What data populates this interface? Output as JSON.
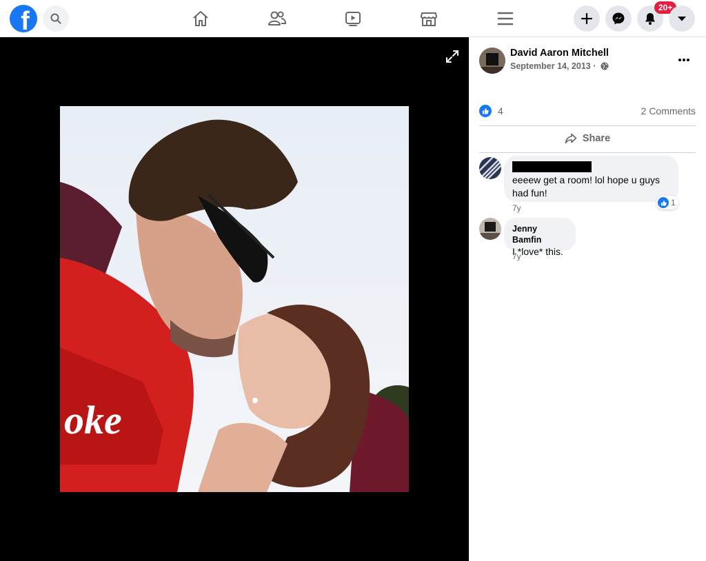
{
  "topbar": {
    "logo_letter": "f",
    "notification_badge": "20+",
    "icons": [
      "facebook-logo",
      "search-icon",
      "home-icon",
      "friends-icon",
      "watch-icon",
      "marketplace-icon",
      "menu-icon",
      "create-icon",
      "messenger-icon",
      "notifications-icon",
      "account-dropdown-icon"
    ]
  },
  "post": {
    "author": "David Aaron Mitchell",
    "date": "September 14, 2013 ·",
    "privacy_icon": "globe-icon",
    "reaction_count": "4",
    "comments_count": "2 Comments",
    "share_label": "Share"
  },
  "comments": [
    {
      "name_redacted": true,
      "text": "eeeew get a room! lol hope u guys had fun!",
      "time": "7y",
      "likes": "1"
    },
    {
      "name": "Jenny Bamfin",
      "text": "I *love* this.",
      "time": "7y"
    }
  ],
  "colors": {
    "brand": "#1877f2",
    "badge": "#e41e3f",
    "photo_background": "#000000",
    "secondary_text": "#65676b"
  }
}
